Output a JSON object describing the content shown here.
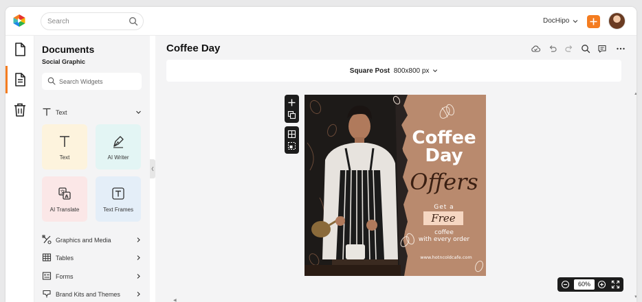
{
  "topbar": {
    "search_placeholder": "Search",
    "workspace": "DocHipo",
    "accent_color": "#f47c20"
  },
  "rail": {
    "items": [
      {
        "icon": "document-icon"
      },
      {
        "icon": "document-text-icon",
        "active": true
      },
      {
        "icon": "trash-icon"
      }
    ]
  },
  "panel": {
    "title": "Documents",
    "subtitle": "Social Graphic",
    "search_placeholder": "Search Widgets",
    "text_section": {
      "label": "Text",
      "icon": "text-t-icon"
    },
    "cards": [
      {
        "label": "Text",
        "icon": "text-t-icon",
        "color": "#fdf3dd"
      },
      {
        "label": "AI Writer",
        "icon": "pen-nib-icon",
        "color": "#e3f5f4"
      },
      {
        "label": "AI Translate",
        "icon": "translate-icon",
        "color": "#fbe7e7"
      },
      {
        "label": "Text Frames",
        "icon": "text-frame-icon",
        "color": "#e4eef8"
      }
    ],
    "sections": [
      {
        "label": "Graphics and Media",
        "icon": "shapes-icon"
      },
      {
        "label": "Tables",
        "icon": "table-icon"
      },
      {
        "label": "Forms",
        "icon": "form-icon"
      },
      {
        "label": "Brand Kits and Themes",
        "icon": "palette-icon"
      }
    ]
  },
  "main": {
    "doc_title": "Coffee Day",
    "size_name": "Square Post",
    "size_dims": "800x800 px",
    "zoom": "60%"
  },
  "design": {
    "title_line1": "Coffee",
    "title_line2": "Day",
    "script": "Offers",
    "get_a": "Get a",
    "free": "Free",
    "coffee_line1": "coffee",
    "coffee_line2": "with every order",
    "website": "www.hotncoldcafe.com",
    "bg_color": "#b98a6e"
  }
}
